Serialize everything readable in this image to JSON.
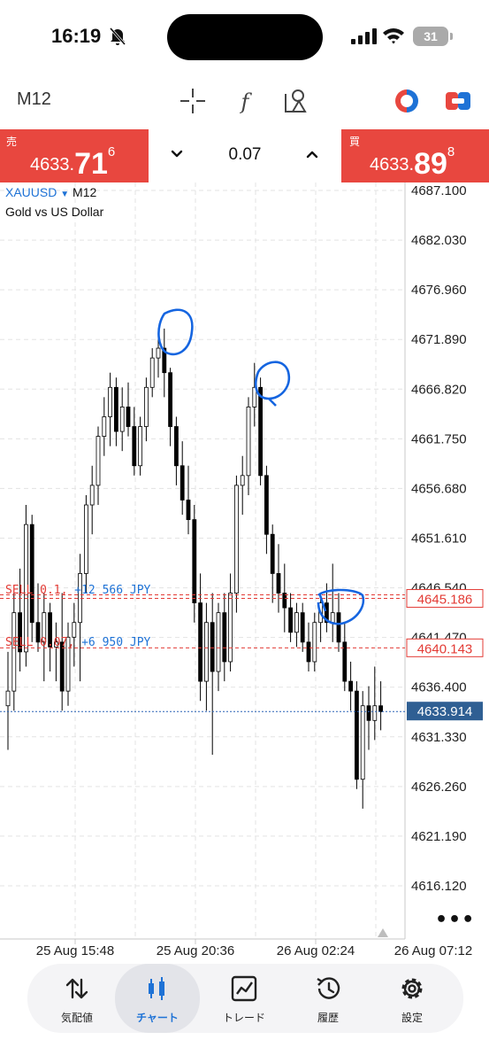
{
  "status_bar": {
    "time": "16:19",
    "battery": "31",
    "icons": [
      "bell-off-icon",
      "cell-signal-icon",
      "wifi-icon",
      "battery-icon"
    ]
  },
  "toolbar": {
    "timeframe": "M12",
    "icons": [
      "crosshair-icon",
      "indicators-f-icon",
      "objects-icon",
      "one-click-trading-icon",
      "trade-panel-icon"
    ]
  },
  "trade_panel": {
    "sell_tag": "売",
    "sell_price_main": "4633.",
    "sell_price_big": "71",
    "sell_price_sup": "6",
    "buy_tag": "買",
    "buy_price_main": "4633.",
    "buy_price_big": "89",
    "buy_price_sup": "8",
    "lot": "0.07"
  },
  "chart_header": {
    "symbol": "XAUUSD",
    "timeframe": "M12",
    "description": "Gold vs US Dollar"
  },
  "positions": [
    {
      "type": "SELL 0.1,",
      "pnl": "+12 566 JPY",
      "price": "4645.186"
    },
    {
      "type": "SELL 0.07,",
      "pnl": "+6 950 JPY",
      "price": "4640.143"
    }
  ],
  "chart_data": {
    "type": "candlestick",
    "y_ticks": [
      "4687.100",
      "4682.030",
      "4676.960",
      "4671.890",
      "4666.820",
      "4661.750",
      "4656.680",
      "4651.610",
      "4646.540",
      "4641.470",
      "4636.400",
      "4631.330",
      "4626.260",
      "4621.190",
      "4616.120"
    ],
    "x_ticks": [
      "25 Aug 15:48",
      "25 Aug 20:36",
      "26 Aug 02:24",
      "26 Aug 07:12"
    ],
    "ylim": [
      4612.0,
      4689.5
    ],
    "current_price": "4633.914",
    "current_value": 4633.914,
    "colors": {
      "up": "#ffffff",
      "down": "#000000",
      "position_line": "#e33b35",
      "bid_line": "#2a62b5",
      "bid_tag": "#2f5f93",
      "annotation": "#1565e0"
    },
    "candles": [
      {
        "o": 4634.5,
        "h": 4640.0,
        "l": 4630.0,
        "c": 4636.0
      },
      {
        "o": 4636.0,
        "h": 4646.0,
        "l": 4634.0,
        "c": 4644.0
      },
      {
        "o": 4644.0,
        "h": 4648.5,
        "l": 4638.0,
        "c": 4640.0
      },
      {
        "o": 4640.0,
        "h": 4655.0,
        "l": 4638.5,
        "c": 4653.0
      },
      {
        "o": 4653.0,
        "h": 4654.0,
        "l": 4641.0,
        "c": 4643.0
      },
      {
        "o": 4643.0,
        "h": 4647.0,
        "l": 4640.0,
        "c": 4641.0
      },
      {
        "o": 4641.0,
        "h": 4646.0,
        "l": 4637.0,
        "c": 4644.0
      },
      {
        "o": 4644.0,
        "h": 4645.0,
        "l": 4638.0,
        "c": 4640.5
      },
      {
        "o": 4640.5,
        "h": 4643.0,
        "l": 4637.0,
        "c": 4641.0
      },
      {
        "o": 4641.0,
        "h": 4646.0,
        "l": 4634.0,
        "c": 4636.0
      },
      {
        "o": 4636.0,
        "h": 4643.0,
        "l": 4634.5,
        "c": 4641.5
      },
      {
        "o": 4641.5,
        "h": 4645.0,
        "l": 4638.5,
        "c": 4643.0
      },
      {
        "o": 4643.0,
        "h": 4650.0,
        "l": 4637.0,
        "c": 4648.0
      },
      {
        "o": 4648.0,
        "h": 4656.0,
        "l": 4646.0,
        "c": 4655.0
      },
      {
        "o": 4655.0,
        "h": 4659.0,
        "l": 4652.0,
        "c": 4657.0
      },
      {
        "o": 4657.0,
        "h": 4663.0,
        "l": 4655.0,
        "c": 4662.0
      },
      {
        "o": 4662.0,
        "h": 4666.0,
        "l": 4660.0,
        "c": 4664.0
      },
      {
        "o": 4664.0,
        "h": 4668.5,
        "l": 4661.0,
        "c": 4667.0
      },
      {
        "o": 4667.0,
        "h": 4668.0,
        "l": 4661.0,
        "c": 4662.5
      },
      {
        "o": 4662.5,
        "h": 4667.0,
        "l": 4660.5,
        "c": 4665.0
      },
      {
        "o": 4665.0,
        "h": 4667.5,
        "l": 4662.0,
        "c": 4663.0
      },
      {
        "o": 4663.0,
        "h": 4665.0,
        "l": 4658.0,
        "c": 4659.0
      },
      {
        "o": 4659.0,
        "h": 4664.0,
        "l": 4658.0,
        "c": 4663.0
      },
      {
        "o": 4663.0,
        "h": 4668.0,
        "l": 4661.5,
        "c": 4667.0
      },
      {
        "o": 4667.0,
        "h": 4671.0,
        "l": 4666.0,
        "c": 4670.0
      },
      {
        "o": 4670.0,
        "h": 4672.5,
        "l": 4668.0,
        "c": 4671.0
      },
      {
        "o": 4671.0,
        "h": 4673.0,
        "l": 4666.0,
        "c": 4668.5
      },
      {
        "o": 4668.5,
        "h": 4669.0,
        "l": 4661.0,
        "c": 4663.0
      },
      {
        "o": 4663.0,
        "h": 4664.0,
        "l": 4657.0,
        "c": 4659.0
      },
      {
        "o": 4659.0,
        "h": 4661.5,
        "l": 4654.0,
        "c": 4655.5
      },
      {
        "o": 4655.5,
        "h": 4659.0,
        "l": 4652.0,
        "c": 4653.5
      },
      {
        "o": 4653.5,
        "h": 4655.0,
        "l": 4643.0,
        "c": 4645.0
      },
      {
        "o": 4645.0,
        "h": 4648.0,
        "l": 4635.0,
        "c": 4637.0
      },
      {
        "o": 4637.0,
        "h": 4645.0,
        "l": 4634.0,
        "c": 4643.0
      },
      {
        "o": 4643.0,
        "h": 4646.0,
        "l": 4629.5,
        "c": 4638.0
      },
      {
        "o": 4638.0,
        "h": 4645.0,
        "l": 4636.0,
        "c": 4644.0
      },
      {
        "o": 4644.0,
        "h": 4646.0,
        "l": 4637.0,
        "c": 4639.0
      },
      {
        "o": 4639.0,
        "h": 4648.0,
        "l": 4638.0,
        "c": 4646.0
      },
      {
        "o": 4646.0,
        "h": 4658.0,
        "l": 4644.0,
        "c": 4657.0
      },
      {
        "o": 4657.0,
        "h": 4660.0,
        "l": 4654.0,
        "c": 4658.0
      },
      {
        "o": 4658.0,
        "h": 4666.0,
        "l": 4656.0,
        "c": 4665.0
      },
      {
        "o": 4665.0,
        "h": 4669.5,
        "l": 4663.0,
        "c": 4667.0
      },
      {
        "o": 4667.0,
        "h": 4668.0,
        "l": 4657.0,
        "c": 4658.0
      },
      {
        "o": 4658.0,
        "h": 4659.0,
        "l": 4650.0,
        "c": 4652.0
      },
      {
        "o": 4652.0,
        "h": 4653.0,
        "l": 4645.0,
        "c": 4648.0
      },
      {
        "o": 4648.0,
        "h": 4651.0,
        "l": 4644.0,
        "c": 4646.0
      },
      {
        "o": 4646.0,
        "h": 4649.0,
        "l": 4642.0,
        "c": 4644.5
      },
      {
        "o": 4644.5,
        "h": 4646.0,
        "l": 4641.0,
        "c": 4642.0
      },
      {
        "o": 4642.0,
        "h": 4645.0,
        "l": 4640.5,
        "c": 4644.0
      },
      {
        "o": 4644.0,
        "h": 4645.0,
        "l": 4640.0,
        "c": 4641.0
      },
      {
        "o": 4641.0,
        "h": 4643.0,
        "l": 4638.0,
        "c": 4639.0
      },
      {
        "o": 4639.0,
        "h": 4644.0,
        "l": 4638.0,
        "c": 4643.0
      },
      {
        "o": 4643.0,
        "h": 4646.0,
        "l": 4641.0,
        "c": 4645.0
      },
      {
        "o": 4645.0,
        "h": 4647.0,
        "l": 4642.0,
        "c": 4643.0
      },
      {
        "o": 4643.0,
        "h": 4649.0,
        "l": 4641.0,
        "c": 4644.0
      },
      {
        "o": 4644.0,
        "h": 4646.0,
        "l": 4640.0,
        "c": 4641.0
      },
      {
        "o": 4641.0,
        "h": 4643.0,
        "l": 4636.0,
        "c": 4637.0
      },
      {
        "o": 4637.0,
        "h": 4639.0,
        "l": 4634.0,
        "c": 4636.0
      },
      {
        "o": 4636.0,
        "h": 4637.0,
        "l": 4626.0,
        "c": 4627.0
      },
      {
        "o": 4627.0,
        "h": 4636.0,
        "l": 4624.0,
        "c": 4634.5
      },
      {
        "o": 4634.5,
        "h": 4636.5,
        "l": 4630.0,
        "c": 4633.0
      },
      {
        "o": 4633.0,
        "h": 4638.5,
        "l": 4631.0,
        "c": 4634.5
      },
      {
        "o": 4634.5,
        "h": 4637.0,
        "l": 4632.0,
        "c": 4633.9
      }
    ]
  },
  "bottom_nav": [
    {
      "label": "気配値",
      "icon": "sort-arrows-icon",
      "active": false
    },
    {
      "label": "チャート",
      "icon": "candlesticks-icon",
      "active": true
    },
    {
      "label": "トレード",
      "icon": "trade-chart-icon",
      "active": false
    },
    {
      "label": "履歴",
      "icon": "history-icon",
      "active": false
    },
    {
      "label": "設定",
      "icon": "settings-gear-icon",
      "active": false
    }
  ]
}
